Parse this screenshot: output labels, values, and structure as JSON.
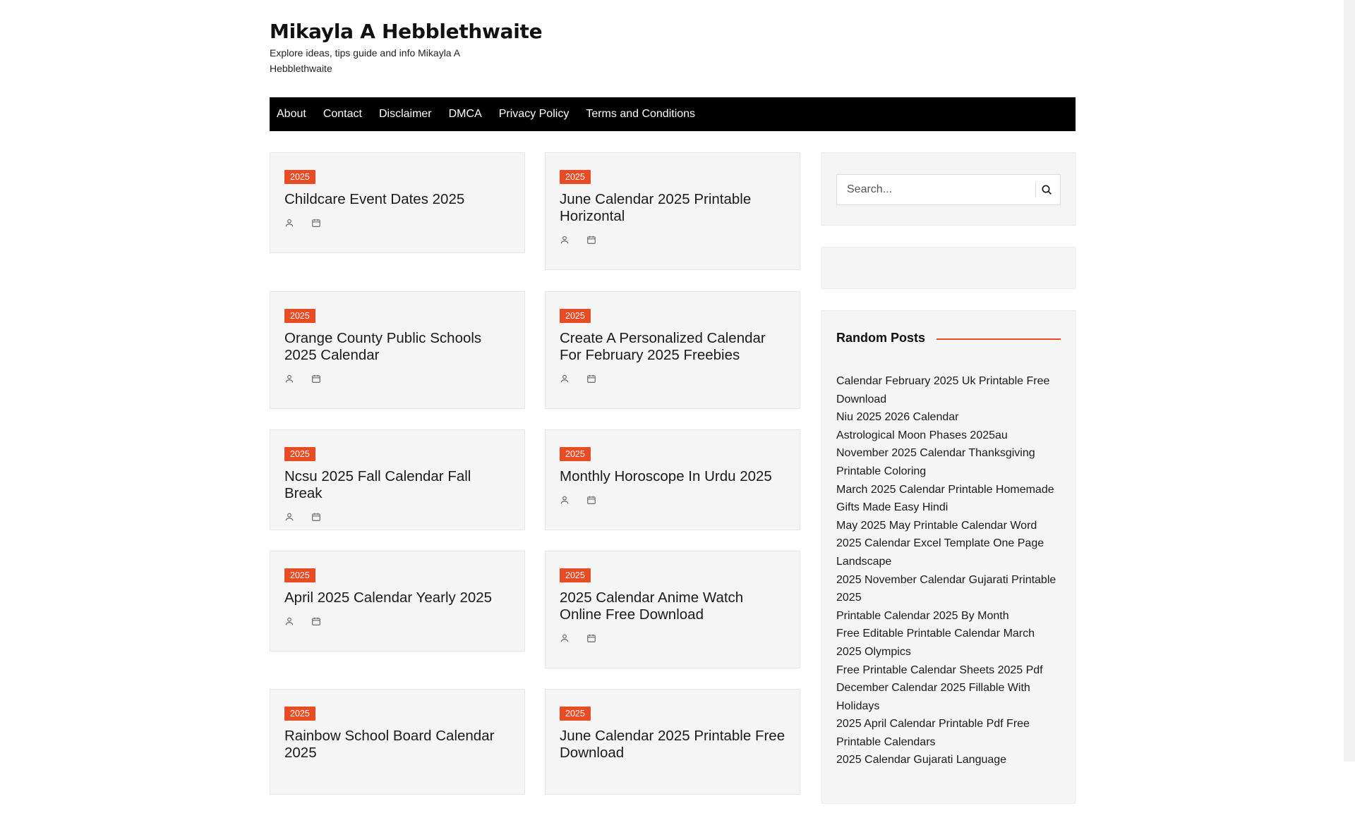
{
  "site": {
    "title": "Mikayla A Hebblethwaite",
    "description": "Explore ideas, tips guide and info Mikayla A Hebblethwaite"
  },
  "nav": {
    "items": [
      "About",
      "Contact",
      "Disclaimer",
      "DMCA",
      "Privacy Policy",
      "Terms and Conditions"
    ]
  },
  "posts": [
    {
      "category": "2025",
      "title": "Childcare Event Dates 2025"
    },
    {
      "category": "2025",
      "title": "June Calendar 2025 Printable Horizontal"
    },
    {
      "category": "2025",
      "title": "Orange County Public Schools 2025 Calendar"
    },
    {
      "category": "2025",
      "title": "Create A Personalized Calendar For February 2025 Freebies"
    },
    {
      "category": "2025",
      "title": "Ncsu 2025 Fall Calendar Fall Break"
    },
    {
      "category": "2025",
      "title": "Monthly Horoscope In Urdu 2025"
    },
    {
      "category": "2025",
      "title": "April 2025 Calendar Yearly 2025"
    },
    {
      "category": "2025",
      "title": "2025 Calendar Anime Watch Online Free Download"
    },
    {
      "category": "2025",
      "title": "Rainbow School Board Calendar 2025"
    },
    {
      "category": "2025",
      "title": "June Calendar 2025 Printable Free Download"
    }
  ],
  "icons": {
    "author": "user-icon",
    "date": "calendar-icon",
    "search": "search-icon"
  },
  "sidebar": {
    "search": {
      "placeholder": "Search..."
    },
    "random_posts": {
      "title": "Random Posts",
      "items": [
        "Calendar February 2025 Uk Printable Free Download",
        "Niu 2025 2026 Calendar",
        "Astrological Moon Phases 2025au",
        "November 2025 Calendar Thanksgiving Printable Coloring",
        "March 2025 Calendar Printable Homemade Gifts Made Easy Hindi",
        "May 2025 May Printable Calendar Word",
        "2025 Calendar Excel Template One Page Landscape",
        "2025 November Calendar Gujarati Printable 2025",
        "Printable Calendar 2025 By Month",
        "Free Editable Printable Calendar March 2025 Olympics",
        "Free Printable Calendar Sheets 2025 Pdf",
        "December Calendar 2025 Fillable With Holidays",
        "2025 April Calendar Printable Pdf Free Printable Calendars",
        "2025 Calendar Gujarati Language"
      ]
    }
  },
  "colors": {
    "accent": "#e74c24",
    "nav_bg": "#000000",
    "card_bg": "#f5f5f5"
  }
}
